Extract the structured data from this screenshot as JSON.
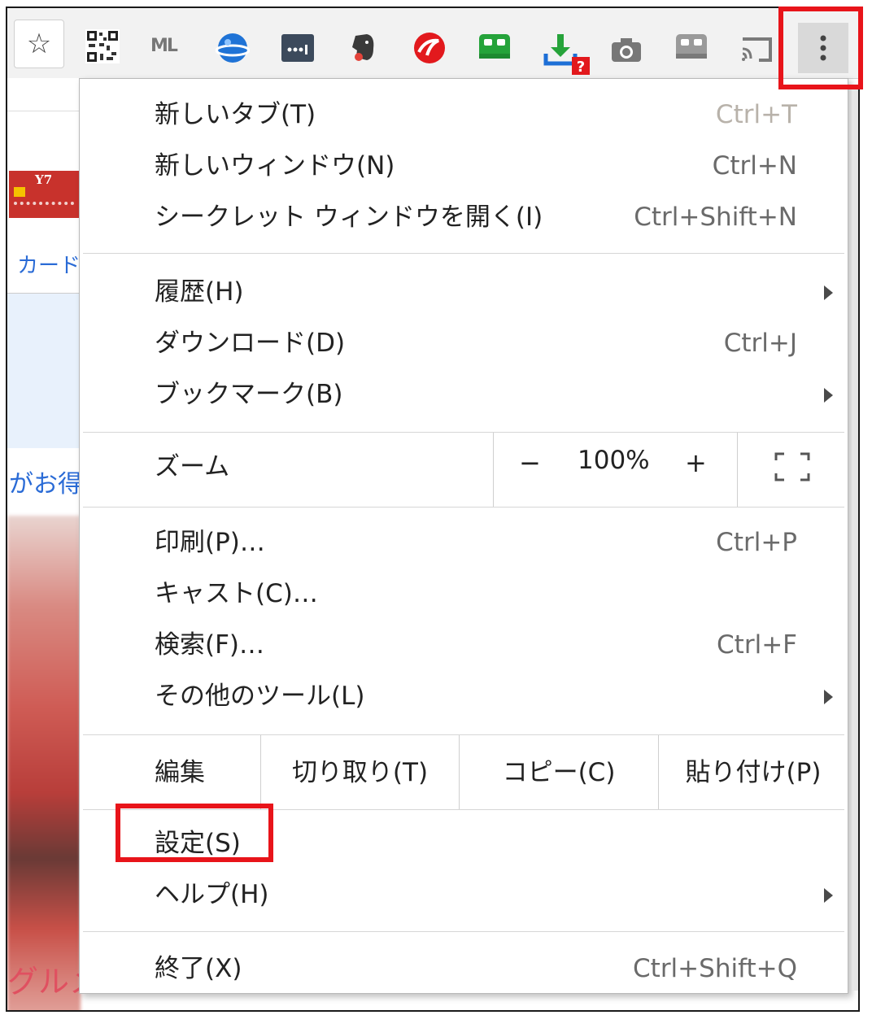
{
  "toolbar": {
    "icons": [
      "bookmark-star-icon",
      "qr-code-icon",
      "ml-icon",
      "globe-icon",
      "dots-password-icon",
      "evernote-icon",
      "trend-micro-icon",
      "green-robot-icon",
      "download-question-icon",
      "camera-icon",
      "robot-icon",
      "cast-icon",
      "more-vert-icon"
    ],
    "ml_text": "ML"
  },
  "background": {
    "card_label": "Y7",
    "link_text": "カード",
    "deal_text": "がお得",
    "gourmet_text": "グルメ"
  },
  "menu": {
    "items": [
      {
        "label": "新しいタブ(T)",
        "shortcut": "Ctrl+T"
      },
      {
        "label": "新しいウィンドウ(N)",
        "shortcut": "Ctrl+N"
      },
      {
        "label": "シークレット ウィンドウを開く(I)",
        "shortcut": "Ctrl+Shift+N"
      },
      {
        "label": "履歴(H)",
        "shortcut": ""
      },
      {
        "label": "ダウンロード(D)",
        "shortcut": "Ctrl+J"
      },
      {
        "label": "ブックマーク(B)",
        "shortcut": ""
      },
      {
        "label": "印刷(P)…",
        "shortcut": "Ctrl+P"
      },
      {
        "label": "キャスト(C)…",
        "shortcut": ""
      },
      {
        "label": "検索(F)…",
        "shortcut": "Ctrl+F"
      },
      {
        "label": "その他のツール(L)",
        "shortcut": ""
      },
      {
        "label": "設定(S)",
        "shortcut": ""
      },
      {
        "label": "ヘルプ(H)",
        "shortcut": ""
      },
      {
        "label": "終了(X)",
        "shortcut": "Ctrl+Shift+Q"
      }
    ],
    "zoom": {
      "label": "ズーム",
      "minus": "−",
      "value": "100%",
      "plus": "+"
    },
    "edit": {
      "label": "編集",
      "cut": "切り取り(T)",
      "copy": "コピー(C)",
      "paste": "貼り付け(P)"
    }
  },
  "colors": {
    "highlight": "#e8141a"
  }
}
